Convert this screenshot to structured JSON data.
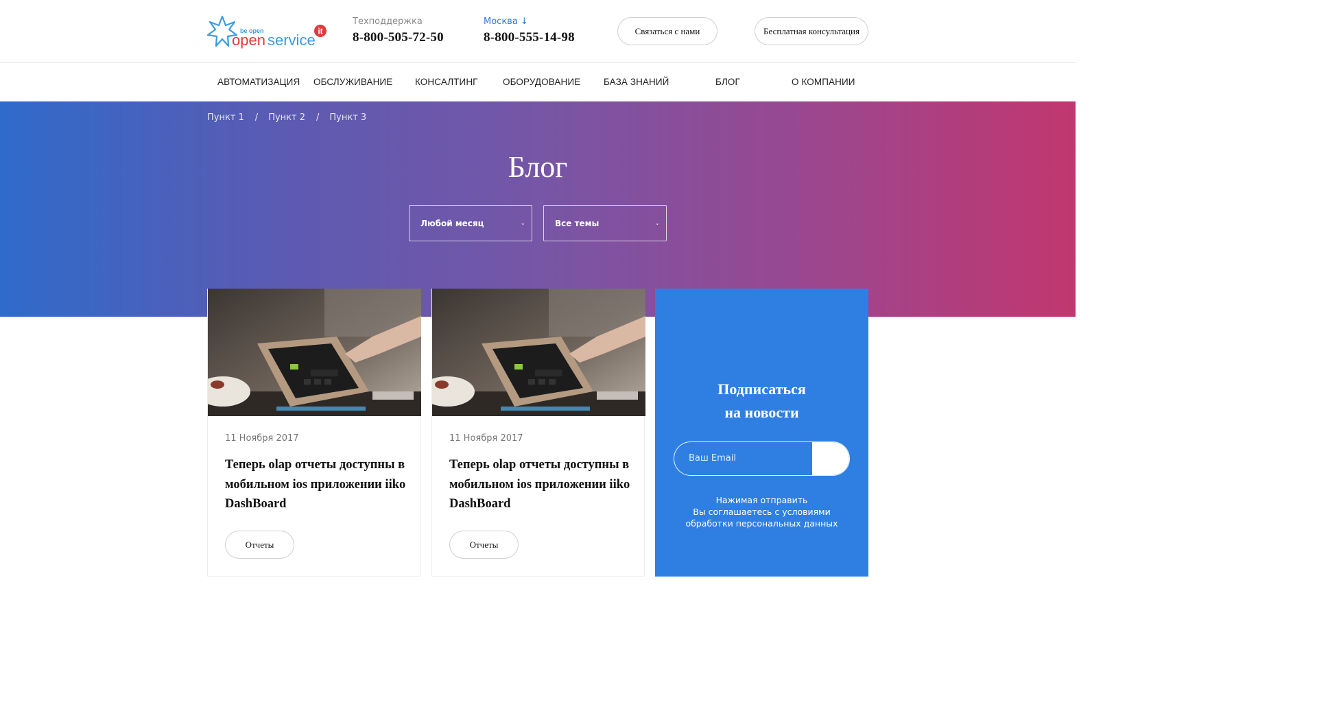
{
  "header": {
    "logo_small": "be open",
    "logo_brand": "openservice",
    "logo_badge": "it",
    "support_label": "Техподдержка",
    "support_phone": "8-800-505-72-50",
    "city_label": "Москва ↓",
    "city_phone": "8-800-555-14-98",
    "contact_button": "Связаться с нами",
    "consult_button": "Бесплатная консультация"
  },
  "nav": {
    "items": [
      {
        "label": "АВТОМАТИЗАЦИЯ"
      },
      {
        "label": "ОБСЛУЖИВАНИЕ"
      },
      {
        "label": "КОНСАЛТИНГ"
      },
      {
        "label": "ОБОРУДОВАНИЕ"
      },
      {
        "label": "БАЗА ЗНАНИЙ"
      },
      {
        "label": "БЛОГ"
      },
      {
        "label": "О КОМПАНИИ"
      }
    ]
  },
  "hero": {
    "breadcrumbs": [
      "Пункт 1",
      "Пункт 2",
      "Пункт 3"
    ],
    "separator": "/",
    "title": "Блог",
    "month_select": "Любой месяц",
    "theme_select": "Все темы"
  },
  "posts": [
    {
      "date": "11 Ноября 2017",
      "title": "Теперь olap отчеты доступны в мобильном ios приложении iiko DashBoard",
      "tag": "Отчеты"
    },
    {
      "date": "11 Ноября 2017",
      "title": "Теперь olap отчеты доступны в мобильном ios приложении iiko DashBoard",
      "tag": "Отчеты"
    }
  ],
  "subscribe": {
    "title_line1": "Подписаться",
    "title_line2": "на новости",
    "email_placeholder": "Ваш Email",
    "note_line1": "Нажимая отправить",
    "note_line2": "Вы соглашаетесь с условиями",
    "note_line3": "обработки персональных данных"
  },
  "colors": {
    "accent_blue": "#2f7fe3",
    "link_blue": "#2f7ad8",
    "gradient_left": "#2f6bcb",
    "gradient_right": "#c1376f",
    "logo_red": "#e23b3b"
  }
}
